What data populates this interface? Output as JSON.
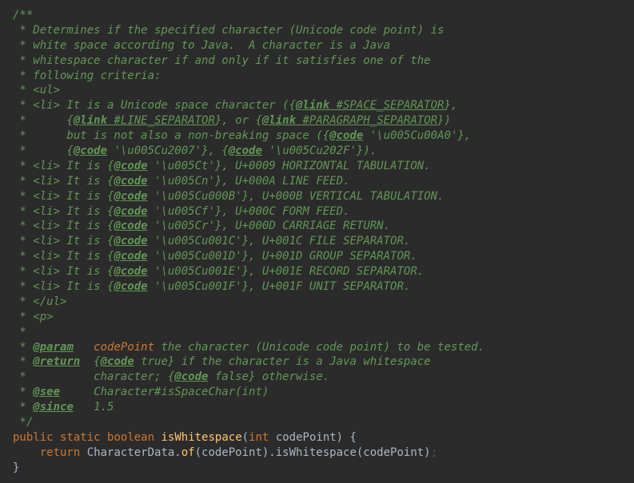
{
  "javadoc": {
    "l1": "/**",
    "l2": " * Determines if the specified character (Unicode code point) is",
    "l3": " * white space according to Java.  A character is a Java",
    "l4": " * whitespace character if and only if it satisfies one of the",
    "l5": " * following criteria:",
    "l6": " * <ul>",
    "l7a": " * <li> It is a Unicode space character ({",
    "l7b": "@link",
    "l7c": " #SPACE_SEPARATOR",
    "l7d": "},",
    "l8a": " *      {",
    "l8b": "@link",
    "l8c": " #LINE_SEPARATOR",
    "l8d": "}, or {",
    "l8e": "@link",
    "l8f": " #PARAGRAPH_SEPARATOR",
    "l8g": "})",
    "l9a": " *      but is not also a non-breaking space ({",
    "l9b": "@code",
    "l9c": " '\\u005Cu00A0'",
    "l9d": "},",
    "l10a": " *      {",
    "l10b": "@code",
    "l10c": " '\\u005Cu2007'",
    "l10d": "}, {",
    "l10e": "@code",
    "l10f": " '\\u005Cu202F'",
    "l10g": "}).",
    "l11a": " * <li> It is {",
    "l11b": "@code",
    "l11c": " '\\u005Ct'",
    "l11d": "}, U+0009 HORIZONTAL TABULATION.",
    "l12a": " * <li> It is {",
    "l12b": "@code",
    "l12c": " '\\u005Cn'",
    "l12d": "}, U+000A LINE FEED.",
    "l13a": " * <li> It is {",
    "l13b": "@code",
    "l13c": " '\\u005Cu000B'",
    "l13d": "}, U+000B VERTICAL TABULATION.",
    "l14a": " * <li> It is {",
    "l14b": "@code",
    "l14c": " '\\u005Cf'",
    "l14d": "}, U+000C FORM FEED.",
    "l15a": " * <li> It is {",
    "l15b": "@code",
    "l15c": " '\\u005Cr'",
    "l15d": "}, U+000D CARRIAGE RETURN.",
    "l16a": " * <li> It is {",
    "l16b": "@code",
    "l16c": " '\\u005Cu001C'",
    "l16d": "}, U+001C FILE SEPARATOR.",
    "l17a": " * <li> It is {",
    "l17b": "@code",
    "l17c": " '\\u005Cu001D'",
    "l17d": "}, U+001D GROUP SEPARATOR.",
    "l18a": " * <li> It is {",
    "l18b": "@code",
    "l18c": " '\\u005Cu001E'",
    "l18d": "}, U+001E RECORD SEPARATOR.",
    "l19a": " * <li> It is {",
    "l19b": "@code",
    "l19c": " '\\u005Cu001F'",
    "l19d": "}, U+001F UNIT SEPARATOR.",
    "l20": " * </ul>",
    "l21": " * <p>",
    "l22": " *",
    "l23a": " * ",
    "l23b": "@param",
    "l23c": "   ",
    "l23d": "codePoint",
    "l23e": " the character (Unicode code point) to be tested.",
    "l24a": " * ",
    "l24b": "@return",
    "l24c": "  {",
    "l24d": "@code",
    "l24e": " true} if the character is a Java whitespace",
    "l25a": " *          character; {",
    "l25b": "@code",
    "l25c": " false} otherwise.",
    "l26a": " * ",
    "l26b": "@see",
    "l26c": "     Character#isSpaceChar(int)",
    "l27a": " * ",
    "l27b": "@since",
    "l27c": "   1.5",
    "l28": " */"
  },
  "code": {
    "kw_public": "public",
    "kw_static": "static",
    "kw_boolean": "boolean",
    "method": "isWhitespace",
    "paren_open": "(",
    "kw_int": "int",
    "param": "codePoint",
    "paren_close_brace": ") {",
    "kw_return": "return",
    "call_part1": " CharacterData.",
    "call_of": "of",
    "call_part2": "(codePoint).isWhitespace(codePoint)",
    "semicolon": ";",
    "close_brace": "}"
  }
}
